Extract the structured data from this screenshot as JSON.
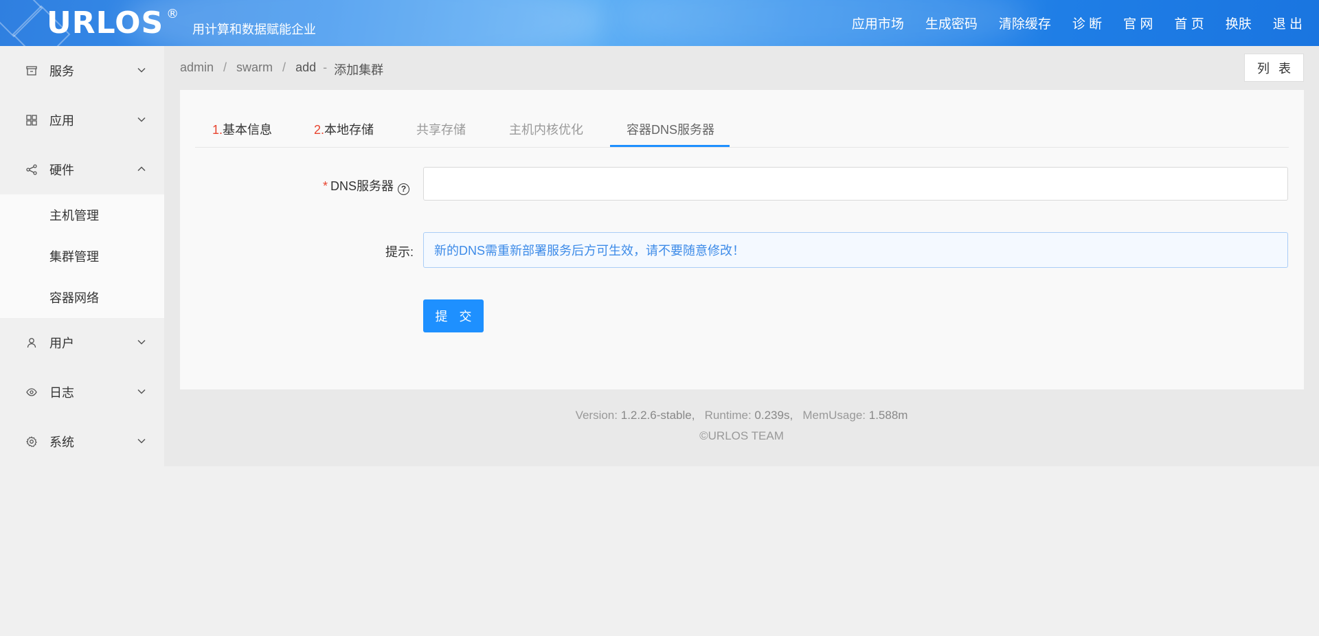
{
  "header": {
    "logo": "URLOS",
    "registered": "®",
    "slogan": "用计算和数据赋能企业",
    "nav": [
      "应用市场",
      "生成密码",
      "清除缓存",
      "诊 断",
      "官 网",
      "首 页",
      "换肤",
      "退 出"
    ]
  },
  "sidebar": {
    "items": [
      {
        "label": "服务",
        "icon": "store-icon",
        "expanded": false
      },
      {
        "label": "应用",
        "icon": "grid-icon",
        "expanded": false
      },
      {
        "label": "硬件",
        "icon": "share-icon",
        "expanded": true
      },
      {
        "label": "用户",
        "icon": "user-icon",
        "expanded": false
      },
      {
        "label": "日志",
        "icon": "eye-icon",
        "expanded": false
      },
      {
        "label": "系统",
        "icon": "gear-icon",
        "expanded": false
      }
    ],
    "hardware_sub": [
      "主机管理",
      "集群管理",
      "容器网络"
    ]
  },
  "breadcrumb": {
    "items": [
      "admin",
      "swarm",
      "add"
    ],
    "separator": "/",
    "dash": "-",
    "current": "添加集群"
  },
  "list_button": "列 表",
  "tabs": [
    {
      "num": "1.",
      "label": "基本信息",
      "state": "done"
    },
    {
      "num": "2.",
      "label": "本地存储",
      "state": "done"
    },
    {
      "num": "",
      "label": "共享存储",
      "state": "pending"
    },
    {
      "num": "",
      "label": "主机内核优化",
      "state": "pending"
    },
    {
      "num": "",
      "label": "容器DNS服务器",
      "state": "active"
    }
  ],
  "form": {
    "dns_label": "DNS服务器",
    "required_mark": "*",
    "help": "?",
    "dns_value": "",
    "hint_label": "提示:",
    "hint_text": "新的DNS需重新部署服务后方可生效，请不要随意修改！",
    "submit": "提 交"
  },
  "footer": {
    "version_label": "Version:",
    "version": "1.2.2.6-stable,",
    "runtime_label": "Runtime:",
    "runtime": "0.239s,",
    "mem_label": "MemUsage:",
    "mem": "1.588m",
    "copyright": "©URLOS TEAM"
  },
  "colors": {
    "primary": "#1e90ff",
    "step_number": "#e8442f",
    "hint_text": "#3d8be8"
  }
}
